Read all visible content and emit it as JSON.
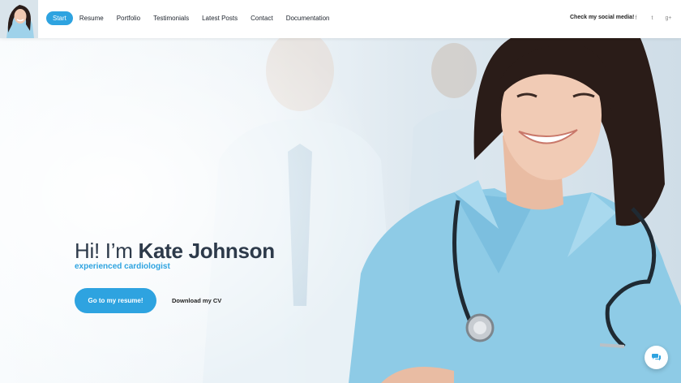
{
  "header": {
    "avatar_alt": "Kate Johnson",
    "nav": [
      {
        "label": "Start",
        "active": true
      },
      {
        "label": "Resume"
      },
      {
        "label": "Portfolio"
      },
      {
        "label": "Testimonials"
      },
      {
        "label": "Latest Posts"
      },
      {
        "label": "Contact"
      },
      {
        "label": "Documentation"
      }
    ],
    "social_label": "Check my social media!",
    "social_icons": [
      {
        "icon": "facebook-icon",
        "glyph": "f"
      },
      {
        "icon": "twitter-icon",
        "glyph": "t"
      },
      {
        "icon": "google-plus-icon",
        "glyph": "g+"
      }
    ]
  },
  "hero": {
    "greeting": "Hi! I’m",
    "name": "Kate Johnson",
    "subtitle": "experienced cardiologist",
    "primary_button": "Go to my resume!",
    "secondary_button": "Download my CV"
  },
  "colors": {
    "accent": "#2ea3e0",
    "title": "#2d3a4a",
    "scrub": "#8ecbe6"
  },
  "chat": {
    "icon": "chat-icon"
  }
}
